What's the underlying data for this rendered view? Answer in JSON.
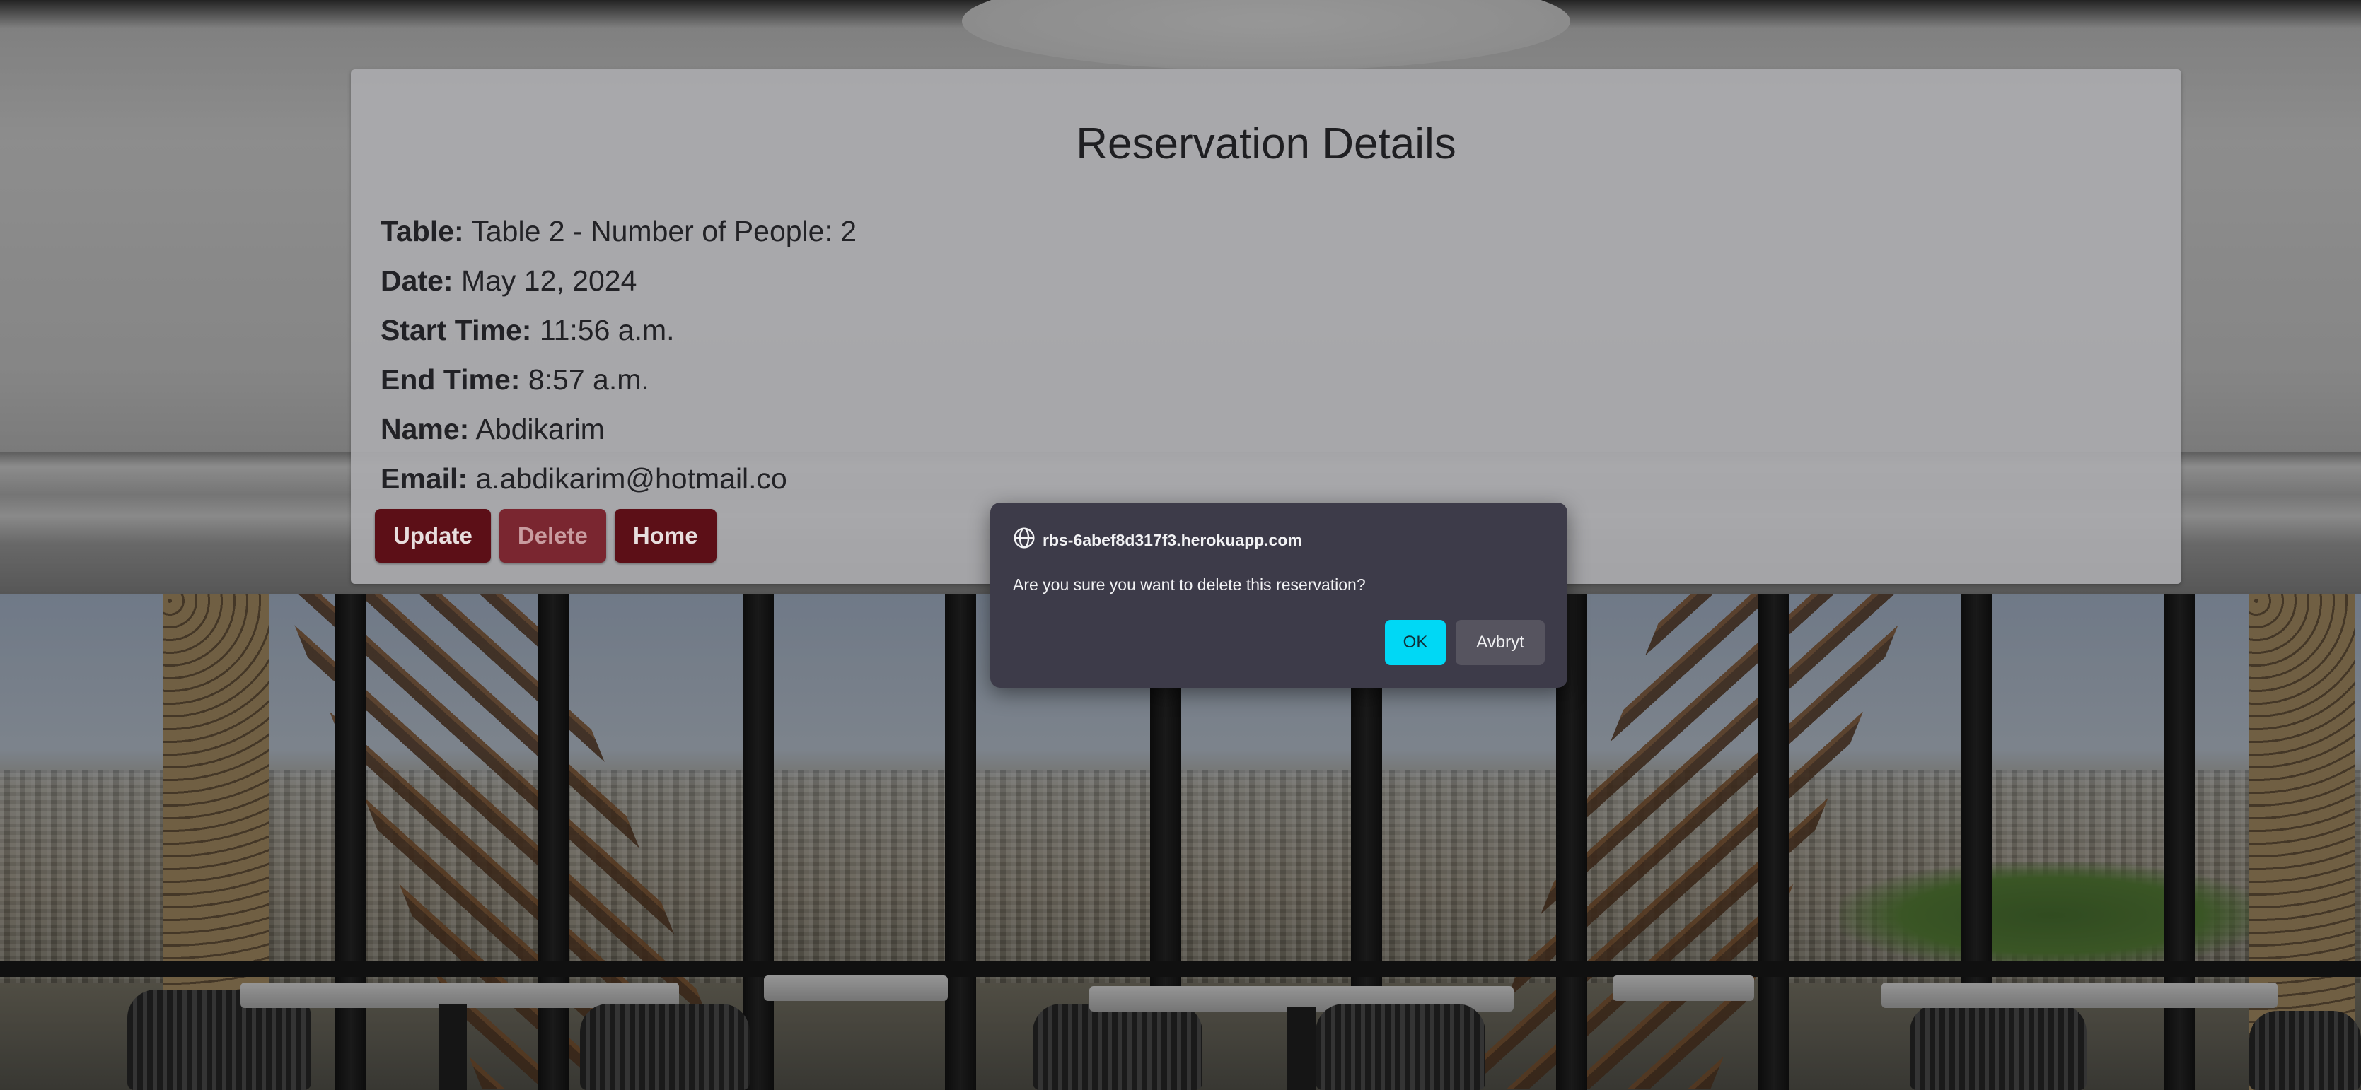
{
  "reservation": {
    "title": "Reservation Details",
    "fields": [
      {
        "label": "Table:",
        "value": "Table 2 - Number of People: 2"
      },
      {
        "label": "Date:",
        "value": "May 12, 2024"
      },
      {
        "label": "Start Time:",
        "value": "11:56 a.m."
      },
      {
        "label": "End Time:",
        "value": "8:57 a.m."
      },
      {
        "label": "Name:",
        "value": "Abdikarim"
      },
      {
        "label": "Email:",
        "value": "a.abdikarim@hotmail.co"
      }
    ],
    "buttons": {
      "update": "Update",
      "delete": "Delete",
      "home": "Home"
    }
  },
  "dialog": {
    "origin": "rbs-6abef8d317f3.herokuapp.com",
    "message": "Are you sure you want to delete this reservation?",
    "ok_label": "OK",
    "cancel_label": "Avbryt",
    "origin_icon": "globe-icon"
  },
  "colors": {
    "button_primary": "#5c0f17",
    "button_delete": "#7a2630",
    "dialog_background": "#3d3b49",
    "dialog_ok": "#00d8f5"
  }
}
